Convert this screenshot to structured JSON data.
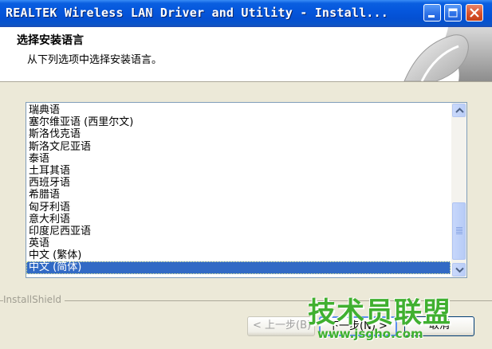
{
  "window": {
    "title": "REALTEK Wireless LAN Driver and Utility - Install...",
    "header_title": "选择安装语言",
    "header_subtitle": "从下列选项中选择安装语言。"
  },
  "languages": {
    "items": [
      "瑞典语",
      "塞尔维亚语 (西里尔文)",
      "斯洛伐克语",
      "斯洛文尼亚语",
      "泰语",
      "土耳其语",
      "西班牙语",
      "希腊语",
      "匈牙利语",
      "意大利语",
      "印度尼西亚语",
      "英语",
      "中文 (繁体)",
      "中文 (简体)"
    ],
    "selected": "中文 (简体)"
  },
  "footer": {
    "brand": "InstallShield",
    "back_label": "< 上一步(B)",
    "next_label": "下一步(N) >",
    "cancel_label": "取消"
  },
  "watermark": {
    "text": "技术员联盟",
    "url": "www.jsgho.com"
  },
  "colors": {
    "titlebar": "#0556dc",
    "selection": "#316ac5",
    "watermark": "#40b030"
  },
  "icons": [
    "minimize-icon",
    "maximize-icon",
    "close-icon",
    "scroll-up-icon",
    "scroll-down-icon"
  ]
}
